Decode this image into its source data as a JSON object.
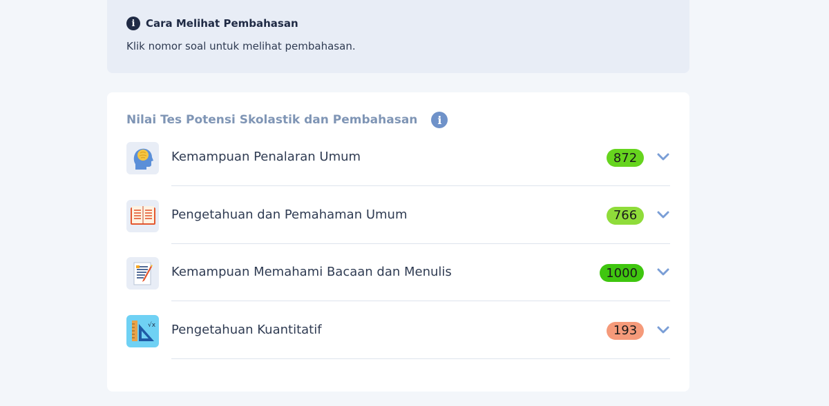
{
  "info": {
    "title": "Cara Melihat Pembahasan",
    "text": "Klik nomor soal untuk melihat pembahasan.",
    "icon": "info-circle-icon"
  },
  "card": {
    "title": "Nilai Tes Potensi Skolastik dan Pembahasan",
    "info_icon": "info-circle-icon",
    "rows": [
      {
        "label": "Kemampuan Penalaran Umum",
        "score": "872",
        "score_color": "#66d41e",
        "icon": "brain-head-icon"
      },
      {
        "label": "Pengetahuan dan Pemahaman Umum",
        "score": "766",
        "score_color": "#8fdc3a",
        "icon": "open-book-icon"
      },
      {
        "label": "Kemampuan Memahami Bacaan dan Menulis",
        "score": "1000",
        "score_color": "#3fc60f",
        "icon": "writing-document-icon"
      },
      {
        "label": "Pengetahuan Kuantitatif",
        "score": "193",
        "score_color": "#f59a7a",
        "icon": "ruler-math-icon"
      }
    ]
  },
  "colors": {
    "accent": "#6f92c9",
    "background": "#f3f6fa",
    "info_box": "#e8edf6"
  }
}
